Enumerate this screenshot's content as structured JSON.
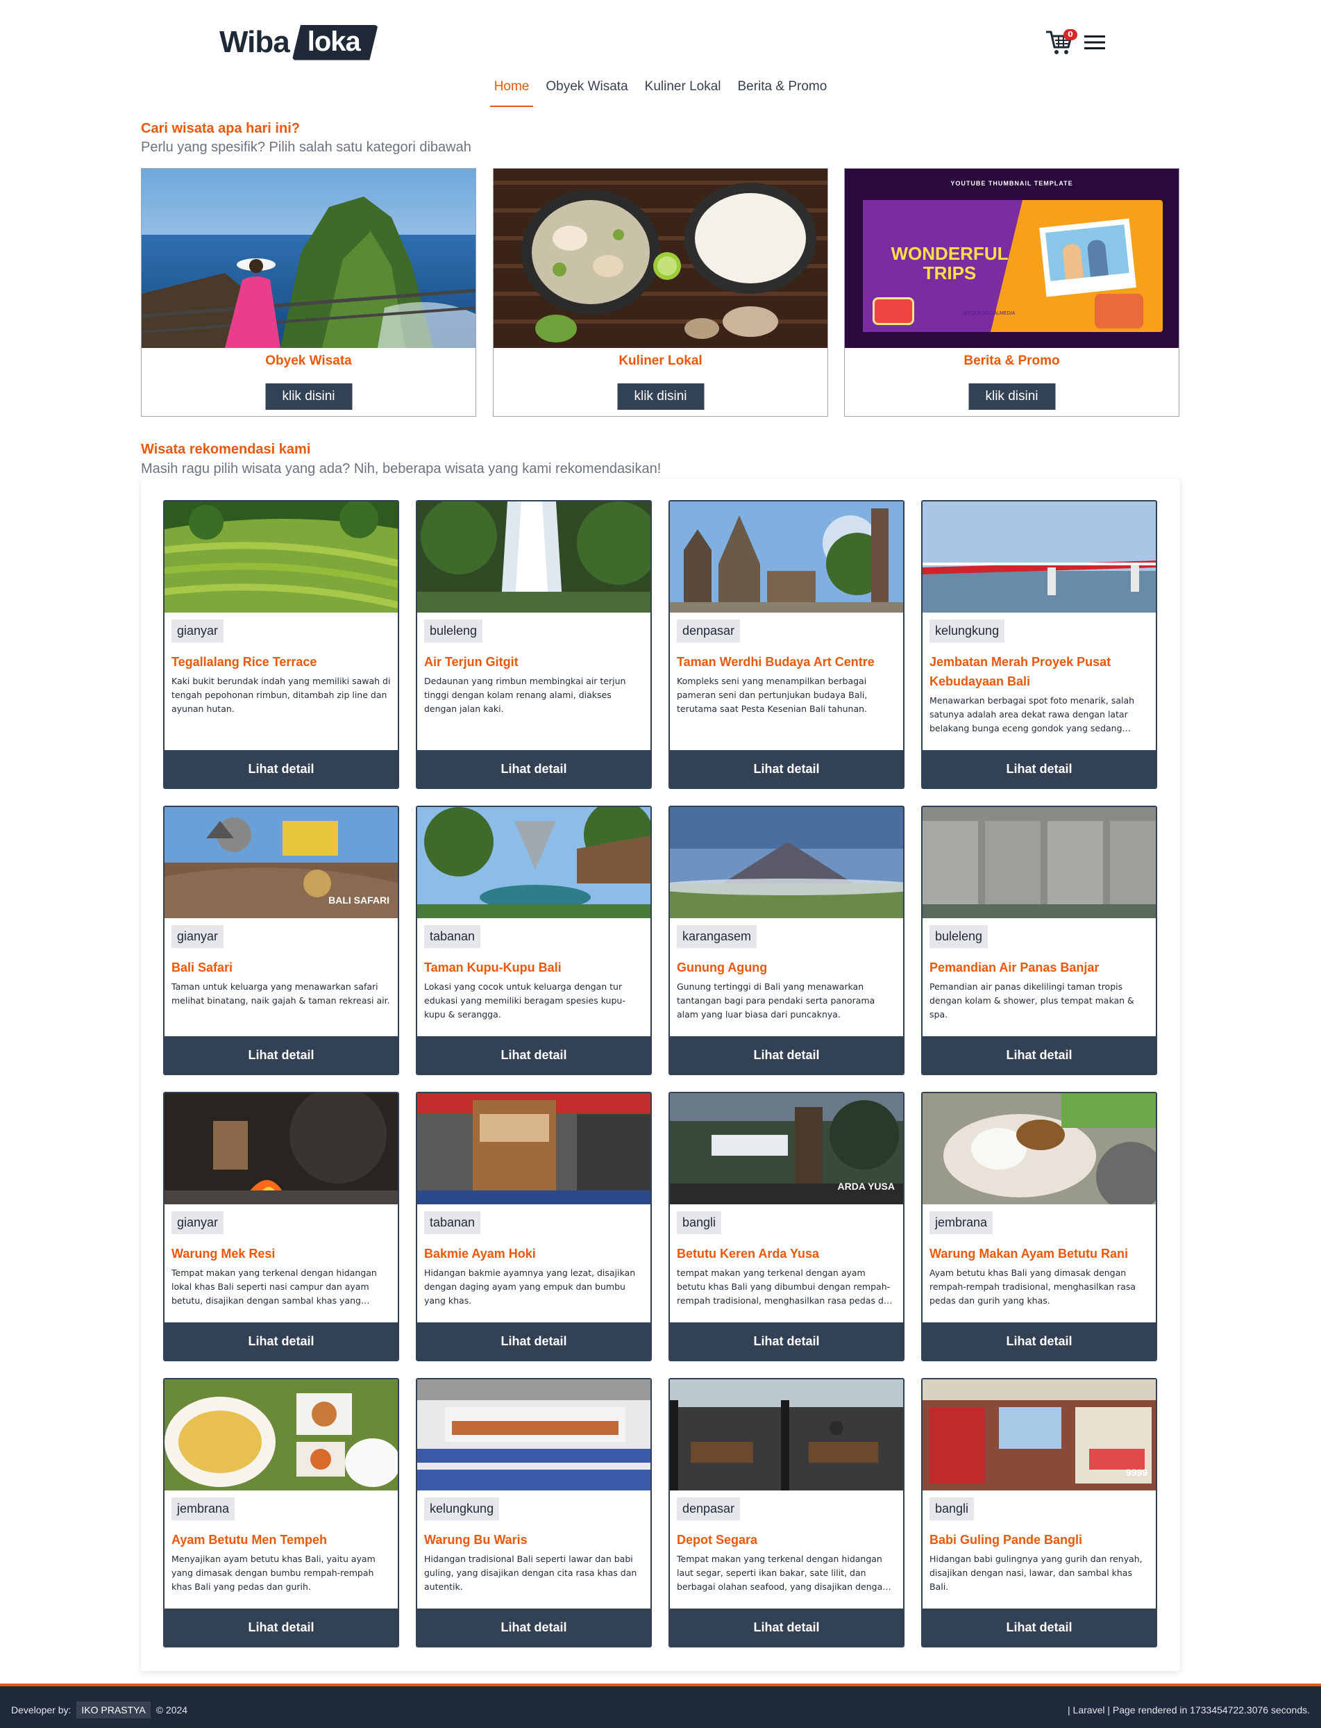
{
  "brand": {
    "part1": "Wiba",
    "part2": "loka"
  },
  "cart": {
    "count": "0"
  },
  "nav": {
    "items": [
      "Home",
      "Obyek Wisata",
      "Kuliner Lokal",
      "Berita & Promo"
    ]
  },
  "search_section": {
    "title": "Cari wisata apa hari ini?",
    "subtitle": "Perlu yang spesifik? Pilih salah satu kategori dibawah"
  },
  "categories": [
    {
      "title": "Obyek Wisata",
      "button": "klik disini"
    },
    {
      "title": "Kuliner Lokal",
      "button": "klik disini"
    },
    {
      "title": "Berita & Promo",
      "button": "klik disini",
      "thumb_top": "YOUTUBE THUMBNAIL TEMPLATE",
      "thumb_main": "WONDERFUL TRIPS",
      "thumb_handle": "@YOURSOCIALMEDIA"
    }
  ],
  "reco_section": {
    "title": "Wisata rekomendasi kami",
    "subtitle": "Masih ragu pilih wisata yang ada? Nih, beberapa wisata yang kami rekomendasikan!"
  },
  "places": [
    {
      "tag": "gianyar",
      "title": "Tegallalang Rice Terrace",
      "desc": "Kaki bukit berundak indah yang memiliki sawah di tengah pepohonan rimbun, ditambah zip line dan ayunan hutan.",
      "button": "Lihat detail"
    },
    {
      "tag": "buleleng",
      "title": "Air Terjun Gitgit",
      "desc": "Dedaunan yang rimbun membingkai air terjun tinggi dengan kolam renang alami, diakses dengan jalan kaki.",
      "button": "Lihat detail"
    },
    {
      "tag": "denpasar",
      "title": "Taman Werdhi Budaya Art Centre",
      "desc": "Kompleks seni yang menampilkan berbagai pameran seni dan pertunjukan budaya Bali, terutama saat Pesta Kesenian Bali tahunan.",
      "button": "Lihat detail"
    },
    {
      "tag": "kelungkung",
      "title": "Jembatan Merah Proyek Pusat Kebudayaan Bali",
      "desc": "Menawarkan berbagai spot foto menarik, salah satunya adalah area dekat rawa dengan latar belakang bunga eceng gondok yang sedang mekar.",
      "button": "Lihat detail"
    },
    {
      "tag": "gianyar",
      "title": "Bali Safari",
      "desc": "Taman untuk keluarga yang menawarkan safari melihat binatang, naik gajah & taman rekreasi air.",
      "button": "Lihat detail",
      "img_text": "BALI SAFARI"
    },
    {
      "tag": "tabanan",
      "title": "Taman Kupu-Kupu Bali",
      "desc": "Lokasi yang cocok untuk keluarga dengan tur edukasi yang memiliki beragam spesies kupu-kupu & serangga.",
      "button": "Lihat detail"
    },
    {
      "tag": "karangasem",
      "title": "Gunung Agung",
      "desc": "Gunung tertinggi di Bali yang menawarkan tantangan bagi para pendaki serta panorama alam yang luar biasa dari puncaknya.",
      "button": "Lihat detail"
    },
    {
      "tag": "buleleng",
      "title": "Pemandian Air Panas Banjar",
      "desc": "Pemandian air panas dikelilingi taman tropis dengan kolam & shower, plus tempat makan & spa.",
      "button": "Lihat detail"
    },
    {
      "tag": "gianyar",
      "title": "Warung Mek Resi",
      "desc": "Tempat makan yang terkenal dengan hidangan lokal khas Bali seperti nasi campur dan ayam betutu, disajikan dengan sambal khas yang pedas.",
      "button": "Lihat detail"
    },
    {
      "tag": "tabanan",
      "title": "Bakmie Ayam Hoki",
      "desc": "Hidangan bakmie ayamnya yang lezat, disajikan dengan daging ayam yang empuk dan bumbu yang khas.",
      "button": "Lihat detail"
    },
    {
      "tag": "bangli",
      "title": "Betutu Keren Arda Yusa",
      "desc": "tempat makan yang terkenal dengan ayam betutu khas Bali yang dibumbui dengan rempah-rempah tradisional, menghasilkan rasa pedas dan gurih ya...",
      "button": "Lihat detail",
      "img_text": "ARDA YUSA"
    },
    {
      "tag": "jembrana",
      "title": "Warung Makan Ayam Betutu Rani",
      "desc": "Ayam betutu khas Bali yang dimasak dengan rempah-rempah tradisional, menghasilkan rasa pedas dan gurih yang khas.",
      "button": "Lihat detail"
    },
    {
      "tag": "jembrana",
      "title": "Ayam Betutu Men Tempeh",
      "desc": "Menyajikan ayam betutu khas Bali, yaitu ayam yang dimasak dengan bumbu rempah-rempah khas Bali yang pedas dan gurih.",
      "button": "Lihat detail"
    },
    {
      "tag": "kelungkung",
      "title": "Warung Bu Waris",
      "desc": "Hidangan tradisional Bali seperti lawar dan babi guling, yang disajikan dengan cita rasa khas dan autentik.",
      "button": "Lihat detail"
    },
    {
      "tag": "denpasar",
      "title": "Depot Segara",
      "desc": "Tempat makan yang terkenal dengan hidangan laut segar, seperti ikan bakar, sate lilit, dan berbagai olahan seafood, yang disajikan dengan bumbu kha...",
      "button": "Lihat detail"
    },
    {
      "tag": "bangli",
      "title": "Babi Guling Pande Bangli",
      "desc": "Hidangan babi gulingnya yang gurih dan renyah, disajikan dengan nasi, lawar, dan sambal khas Bali.",
      "button": "Lihat detail",
      "img_text": "9999"
    }
  ],
  "footer": {
    "dev_label": "Developer by:",
    "dev_name": "IKO PRASTYA",
    "year": "© 2024",
    "right_text": "| Laravel | Page rendered in 1733454722.3076 seconds."
  },
  "colors": {
    "accent": "#ea580c",
    "button": "#334155",
    "footer": "#1e293b"
  }
}
